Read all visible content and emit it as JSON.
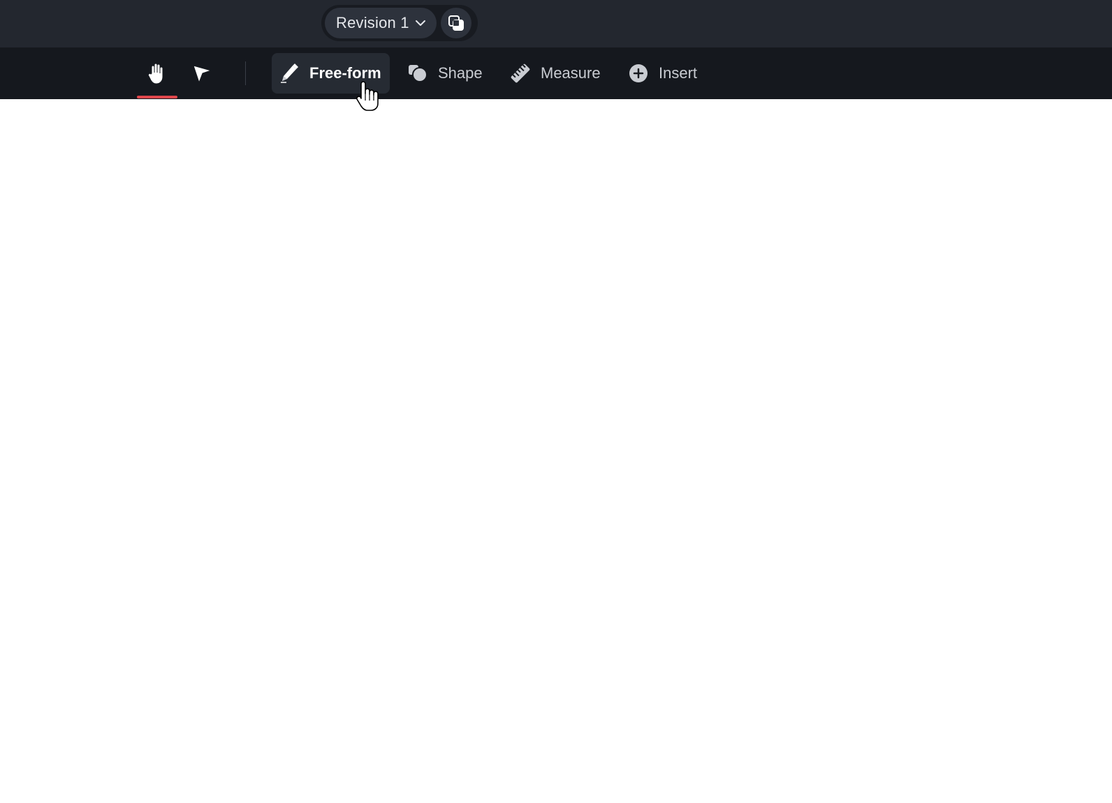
{
  "header": {
    "revision": {
      "label": "Revision 1",
      "chevron_icon": "chevron-down-icon"
    },
    "compare_icon": "overlap-squares-icon"
  },
  "toolbar": {
    "active_tool": "hand",
    "accent_color": "#e0474c",
    "icon_tools": [
      {
        "id": "hand",
        "icon": "hand-icon"
      },
      {
        "id": "select",
        "icon": "pointer-arrow-icon"
      }
    ],
    "tools": [
      {
        "id": "freeform",
        "label": "Free-form",
        "icon": "pencil-icon",
        "highlighted": true
      },
      {
        "id": "shape",
        "label": "Shape",
        "icon": "shapes-icon"
      },
      {
        "id": "measure",
        "label": "Measure",
        "icon": "ruler-icon"
      },
      {
        "id": "insert",
        "label": "Insert",
        "icon": "plus-circle-icon"
      }
    ]
  },
  "colors": {
    "topbar_bg": "#23272f",
    "toolbar_bg": "#15181e",
    "canvas_bg": "#ffffff"
  }
}
